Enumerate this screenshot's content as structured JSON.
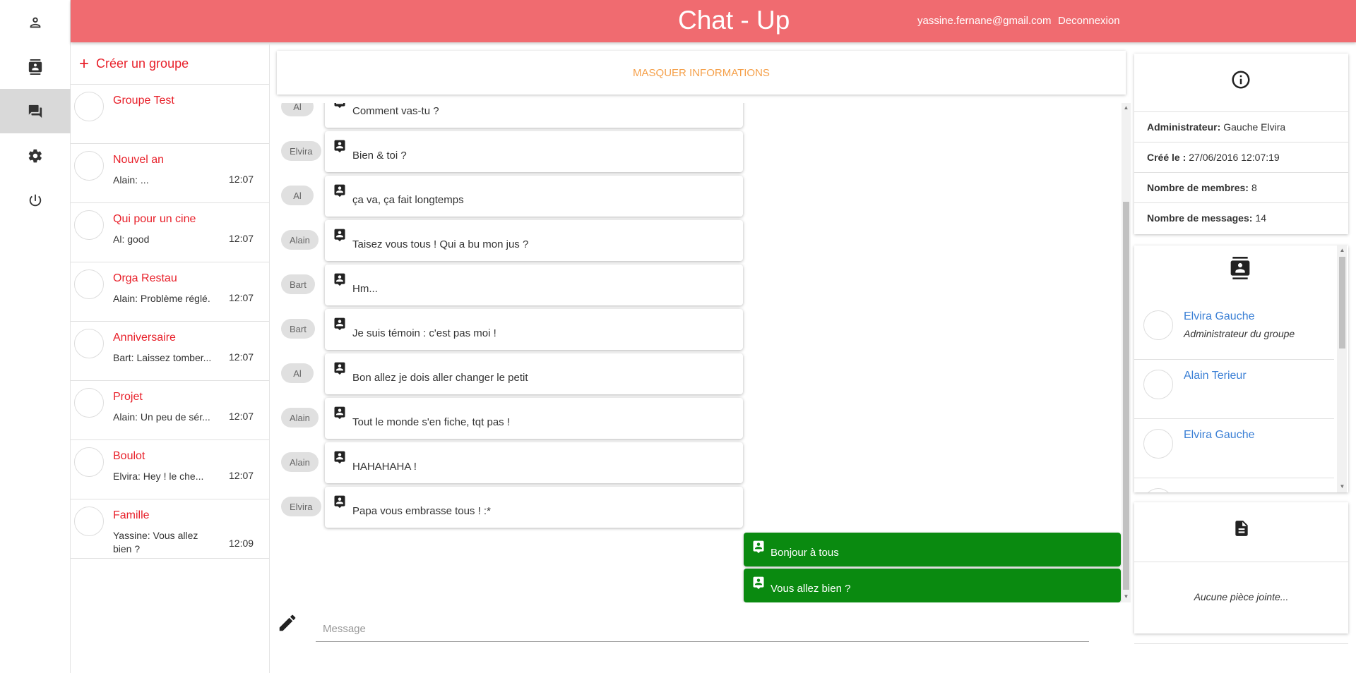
{
  "app": {
    "title": "Chat - Up"
  },
  "header": {
    "user_email": "yassine.fernane@gmail.com",
    "logout_label": "Deconnexion"
  },
  "nav": [
    {
      "icon": "person-icon",
      "active": false
    },
    {
      "icon": "contacts-icon",
      "active": false
    },
    {
      "icon": "chat-icon",
      "active": true
    },
    {
      "icon": "gear-icon",
      "active": false
    },
    {
      "icon": "power-icon",
      "active": false
    }
  ],
  "groups": {
    "create_label": "Créer un groupe",
    "items": [
      {
        "name": "Groupe Test",
        "last": "",
        "time": ""
      },
      {
        "name": "Nouvel an",
        "last": "Alain: ...",
        "time": "12:07"
      },
      {
        "name": "Qui pour un cine",
        "last": "Al: good",
        "time": "12:07"
      },
      {
        "name": "Orga Restau",
        "last": "Alain: Problème réglé.",
        "time": "12:07"
      },
      {
        "name": "Anniversaire",
        "last": "Bart: Laissez tomber...",
        "time": "12:07"
      },
      {
        "name": "Projet",
        "last": "Alain: Un peu de sér...",
        "time": "12:07"
      },
      {
        "name": "Boulot",
        "last": "Elvira: Hey ! le che...",
        "time": "12:07"
      },
      {
        "name": "Famille",
        "last": "Yassine: Vous allez bien ?",
        "time": "12:09"
      }
    ]
  },
  "chat": {
    "toggle_label": "MASQUER INFORMATIONS",
    "messages": [
      {
        "sender": "Al",
        "text": "Comment vas-tu ?"
      },
      {
        "sender": "Elvira",
        "text": "Bien & toi ?"
      },
      {
        "sender": "Al",
        "text": "ça va, ça fait longtemps"
      },
      {
        "sender": "Alain",
        "text": "Taisez vous tous ! Qui a bu mon jus ?"
      },
      {
        "sender": "Bart",
        "text": "Hm..."
      },
      {
        "sender": "Bart",
        "text": "Je suis témoin : c'est pas moi !"
      },
      {
        "sender": "Al",
        "text": "Bon allez je dois aller changer le petit"
      },
      {
        "sender": "Alain",
        "text": "Tout le monde s'en fiche, tqt pas !"
      },
      {
        "sender": "Alain",
        "text": "HAHAHAHA !"
      },
      {
        "sender": "Elvira",
        "text": "Papa vous embrasse tous ! :*"
      }
    ],
    "own_messages": [
      {
        "text": "Bonjour à tous"
      },
      {
        "text": "Vous allez bien ?"
      }
    ],
    "input_placeholder": "Message"
  },
  "info": {
    "admin_label": "Administrateur:",
    "admin_value": "Gauche Elvira",
    "created_label": "Créé le :",
    "created_value": "27/06/2016 12:07:19",
    "members_label": "Nombre de membres:",
    "members_value": "8",
    "messages_label": "Nombre de messages:",
    "messages_value": "14"
  },
  "members": [
    {
      "name": "Elvira Gauche",
      "role": "Administrateur du groupe"
    },
    {
      "name": "Alain Terieur",
      "role": ""
    },
    {
      "name": "Elvira Gauche",
      "role": ""
    }
  ],
  "files": {
    "empty_label": "Aucune pièce jointe..."
  },
  "colors": {
    "header": "#f06b70",
    "accent_red": "#e8202a",
    "own_bubble": "#0a8a10",
    "link_blue": "#3a7fd5",
    "toggle": "#f5a04a"
  }
}
